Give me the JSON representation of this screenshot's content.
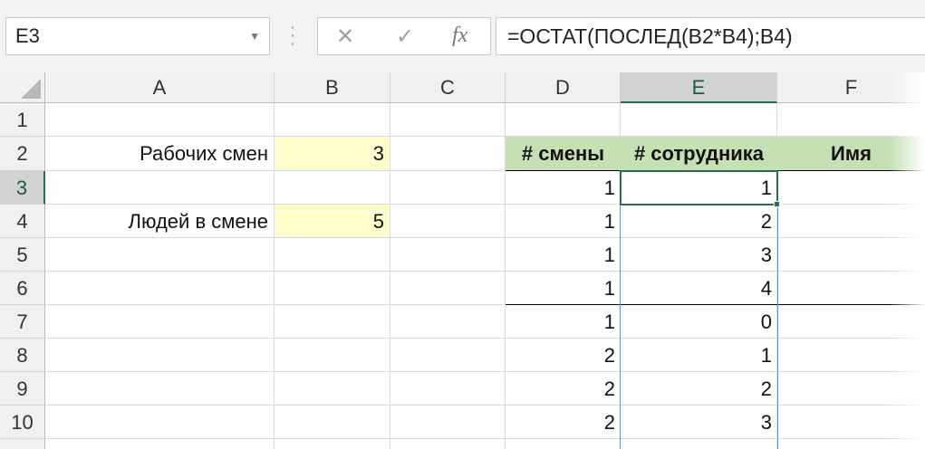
{
  "formula_bar": {
    "name_box": "E3",
    "cancel_icon": "✕",
    "enter_icon": "✓",
    "fx_label": "fx",
    "formula": "=ОСТАТ(ПОСЛЕД(B2*B4);B4)"
  },
  "columns": [
    "A",
    "B",
    "C",
    "D",
    "E",
    "F"
  ],
  "selected_column": "E",
  "rows": [
    "1",
    "2",
    "3",
    "4",
    "5",
    "6",
    "7",
    "8",
    "9",
    "10"
  ],
  "selected_row": "3",
  "cells": {
    "A2": "Рабочих смен",
    "B2": "3",
    "A4": "Людей в смене",
    "B4": "5",
    "D2": "# смены",
    "E2": "# сотрудника",
    "F2": "Имя"
  },
  "table": [
    {
      "shift": "1",
      "employee": "1"
    },
    {
      "shift": "1",
      "employee": "2"
    },
    {
      "shift": "1",
      "employee": "3"
    },
    {
      "shift": "1",
      "employee": "4"
    },
    {
      "shift": "1",
      "employee": "0"
    },
    {
      "shift": "2",
      "employee": "1"
    },
    {
      "shift": "2",
      "employee": "2"
    },
    {
      "shift": "2",
      "employee": "3"
    }
  ],
  "colors": {
    "input_fill": "#ffffcc",
    "header_fill": "#c6e0b4",
    "selection": "#217346",
    "spill_border": "#5b9bd5"
  }
}
